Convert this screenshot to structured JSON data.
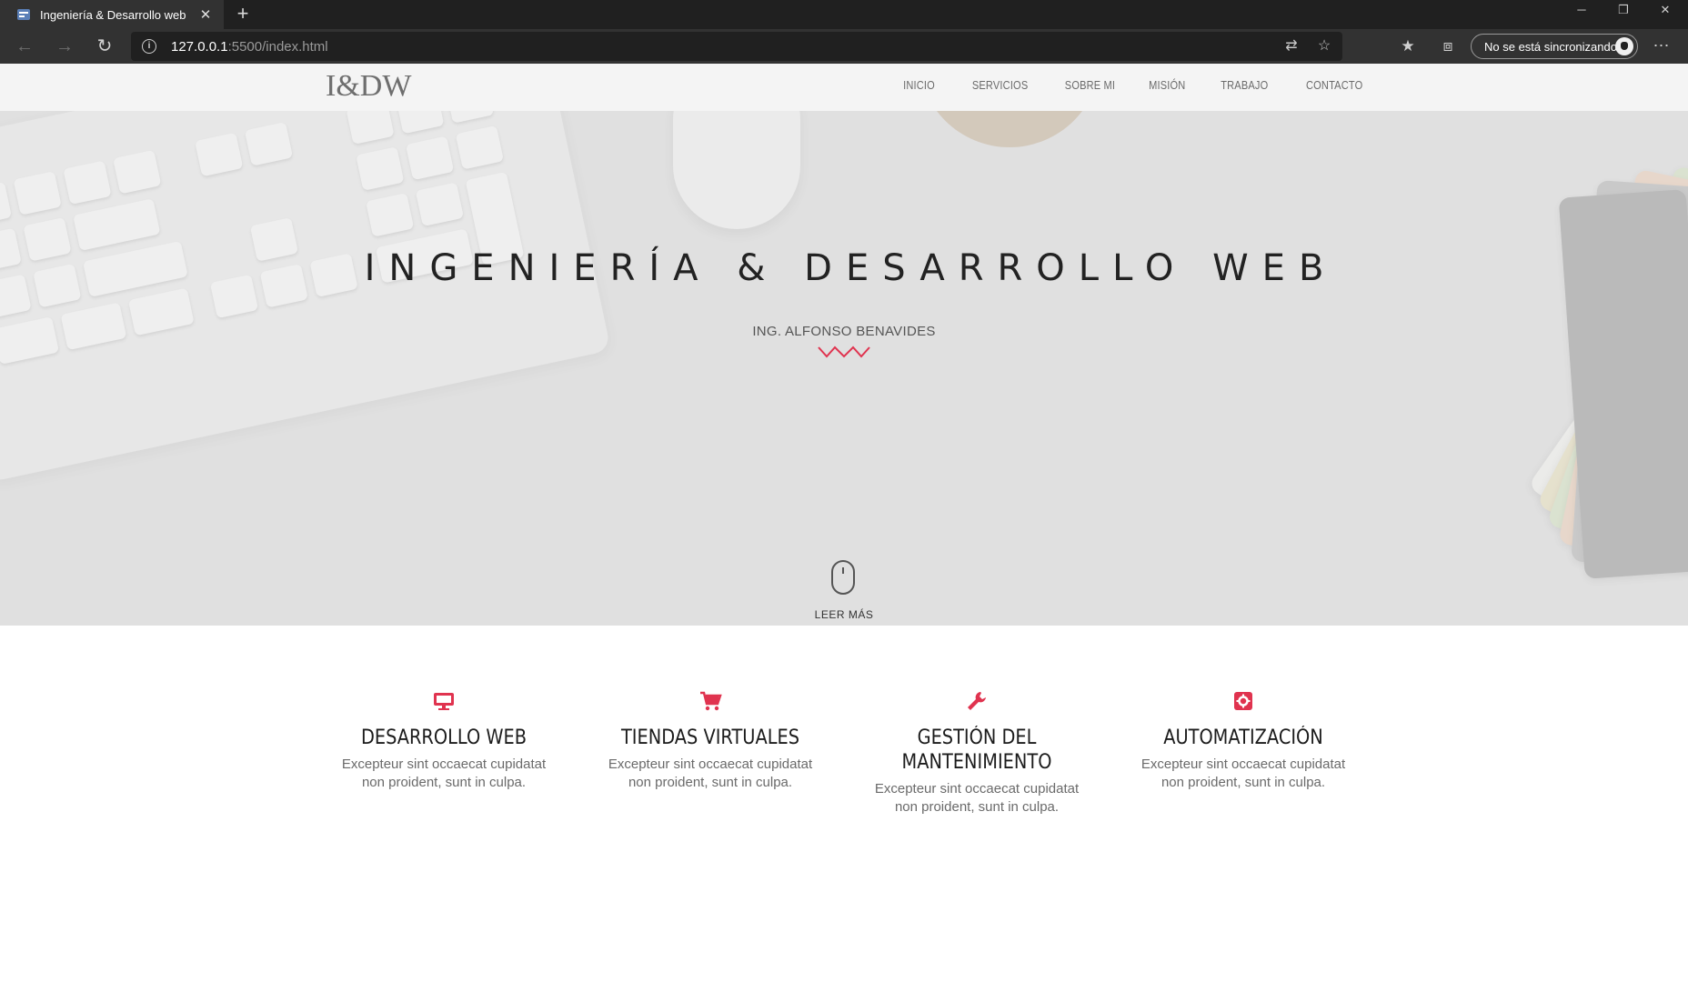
{
  "browser": {
    "tab_title": "Ingeniería & Desarrollo web",
    "tab_close": "✕",
    "new_tab": "+",
    "url_host": "127.0.0.1",
    "url_path": ":5500/index.html",
    "profile_label": "No se está sincronizando",
    "window": {
      "minimize": "─",
      "restore": "❐",
      "close": "✕"
    },
    "icons": [
      "back-arrow-icon",
      "forward-arrow-icon",
      "refresh-icon",
      "info-icon",
      "translate-icon",
      "favorite-star-icon",
      "favorites-icon",
      "collections-icon",
      "settings-more-icon"
    ]
  },
  "site": {
    "logo": "I&DW",
    "nav": [
      "INICIO",
      "SERVICIOS",
      "SOBRE MI",
      "MISIÓN",
      "TRABAJO",
      "CONTACTO"
    ],
    "hero": {
      "title": "INGENIERÍA & DESARROLLO WEB",
      "subtitle": "ING. ALFONSO BENAVIDES",
      "scroll_label": "LEER MÁS"
    },
    "services": [
      {
        "icon": "monitor-icon",
        "title": "DESARROLLO WEB",
        "desc": "Excepteur sint occaecat cupidatat non proident, sunt in culpa."
      },
      {
        "icon": "cart-icon",
        "title": "TIENDAS VIRTUALES",
        "desc": "Excepteur sint occaecat cupidatat non proident, sunt in culpa."
      },
      {
        "icon": "wrench-icon",
        "title": "GESTIÓN DEL MANTENIMIENTO",
        "desc": "Excepteur sint occaecat cupidatat non proident, sunt in culpa."
      },
      {
        "icon": "gear-box-icon",
        "title": "AUTOMATIZACIÓN",
        "desc": "Excepteur sint occaecat cupidatat non proident, sunt in culpa."
      }
    ],
    "colors": {
      "accent": "#e0334f",
      "nav_bg": "#f4f4f4",
      "hero_bg": "#e0e0e0"
    }
  }
}
